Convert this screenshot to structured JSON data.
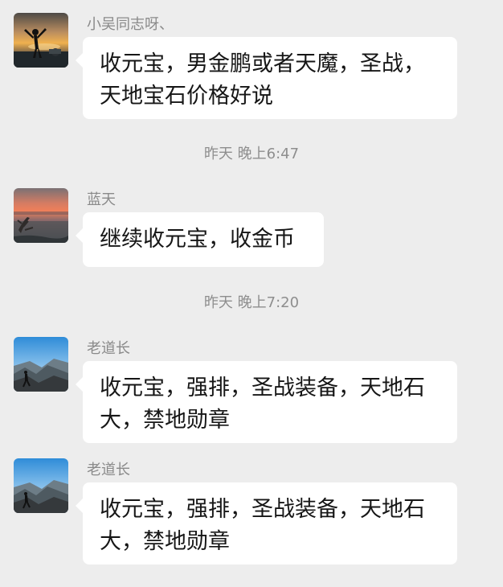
{
  "messages": [
    {
      "sender": "小吴同志呀、",
      "text": "收元宝，男金鹏或者天魔，圣战，\n天地宝石价格好说",
      "avatar_icon": "sunset-person-avatar-icon"
    },
    {
      "sender": "蓝天",
      "text": "继续收元宝，收金币",
      "avatar_icon": "red-sunset-lake-avatar-icon"
    },
    {
      "sender": "老道长",
      "text": "收元宝，强排，圣战装备，天地石\n大，禁地勋章",
      "avatar_icon": "mountain-hiker-avatar-icon"
    },
    {
      "sender": "老道长",
      "text": "收元宝，强排，圣战装备，天地石\n大，禁地勋章",
      "avatar_icon": "mountain-hiker-avatar-icon"
    }
  ],
  "timestamps": [
    "昨天 晚上6:47",
    "昨天 晚上7:20"
  ],
  "colors": {
    "background": "#ededed",
    "bubble": "#ffffff",
    "sender_text": "#8a8a8a",
    "message_text": "#161616"
  }
}
